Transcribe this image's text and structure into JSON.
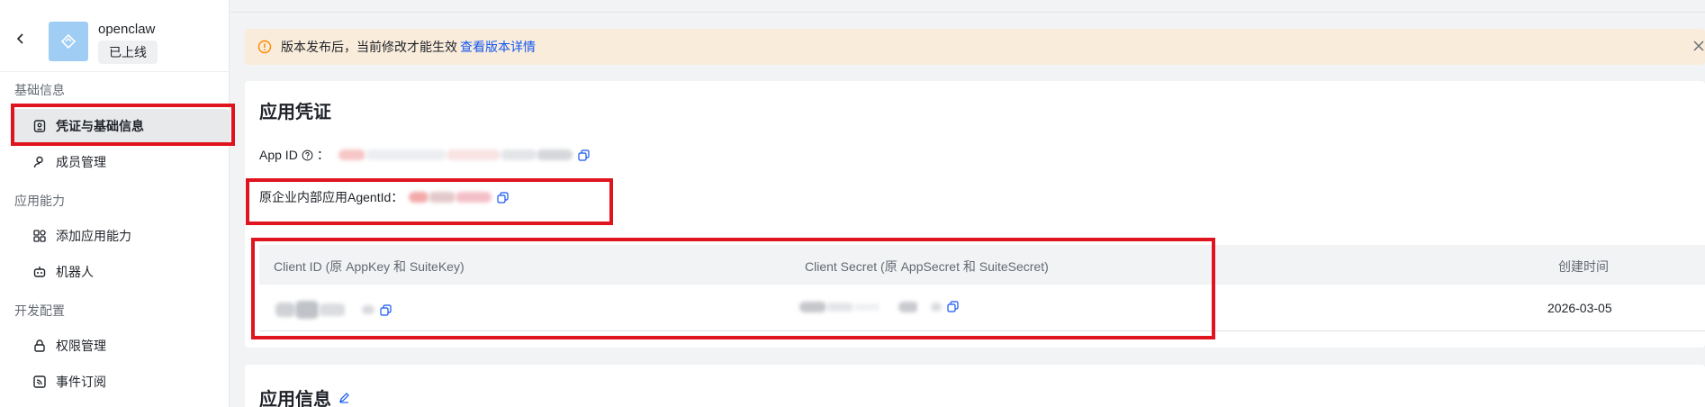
{
  "app": {
    "name": "openclaw",
    "status": "已上线"
  },
  "sidebar": {
    "groups": [
      {
        "label": "基础信息"
      },
      {
        "label": "应用能力"
      },
      {
        "label": "开发配置"
      }
    ],
    "items": [
      {
        "label": "凭证与基础信息",
        "icon": "credential-icon",
        "active": true
      },
      {
        "label": "成员管理",
        "icon": "user-icon"
      },
      {
        "label": "添加应用能力",
        "icon": "apps-grid-icon"
      },
      {
        "label": "机器人",
        "icon": "robot-icon"
      },
      {
        "label": "权限管理",
        "icon": "lock-icon"
      },
      {
        "label": "事件订阅",
        "icon": "rss-icon"
      }
    ]
  },
  "notice": {
    "text": "版本发布后，当前修改才能生效",
    "link": "查看版本详情"
  },
  "credentials": {
    "title": "应用凭证",
    "app_id_label": "App ID",
    "app_id_colon": "：",
    "agent_id_label": "原企业内部应用AgentId：",
    "table": {
      "headers": [
        "Client ID (原 AppKey 和 SuiteKey)",
        "Client Secret (原 AppSecret 和 SuiteSecret)",
        "创建时间"
      ],
      "row": {
        "created": "2026-03-05"
      }
    }
  },
  "app_info": {
    "title": "应用信息"
  },
  "colors": {
    "highlight": "#e0141e",
    "link": "#1456f0",
    "notice_bg": "#f9ecdb"
  }
}
